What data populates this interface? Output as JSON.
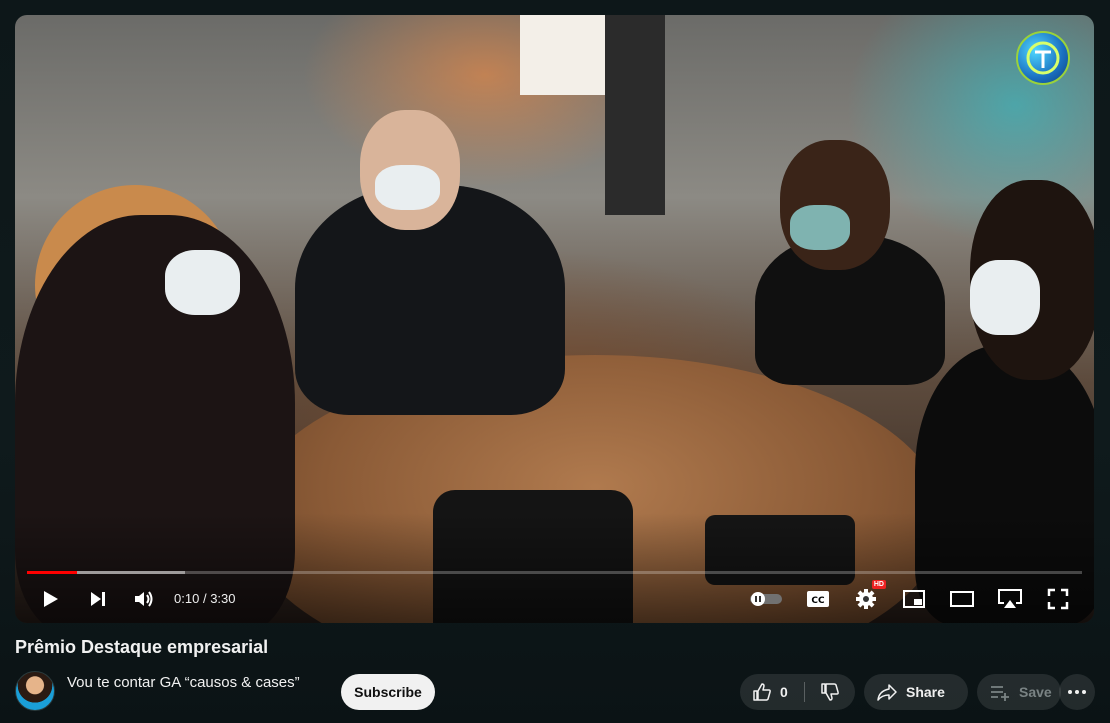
{
  "player": {
    "time_current": "0:10",
    "time_separator": "/",
    "time_total": "3:30",
    "progress_played_fraction": 0.0476,
    "progress_loaded_fraction": 0.15,
    "hd_badge": "HD",
    "icons": {
      "play": "play-icon",
      "next": "next-icon",
      "volume": "volume-icon",
      "autoplay": "autoplay-toggle-icon",
      "captions": "cc-icon",
      "settings": "gear-icon",
      "miniplayer": "miniplayer-icon",
      "theater": "theater-icon",
      "airplay": "airplay-icon",
      "fullscreen": "fullscreen-icon"
    }
  },
  "video": {
    "title": "Prêmio Destaque empresarial"
  },
  "channel": {
    "name": "Vou te contar GA “causos & cases”",
    "subscribe_label": "Subscribe"
  },
  "actions": {
    "like_count": "0",
    "share_label": "Share",
    "save_label": "Save"
  },
  "colors": {
    "progress_played": "#ff0000",
    "background": "#0f1a1c",
    "subscribe_bg": "#f1f1f1"
  }
}
